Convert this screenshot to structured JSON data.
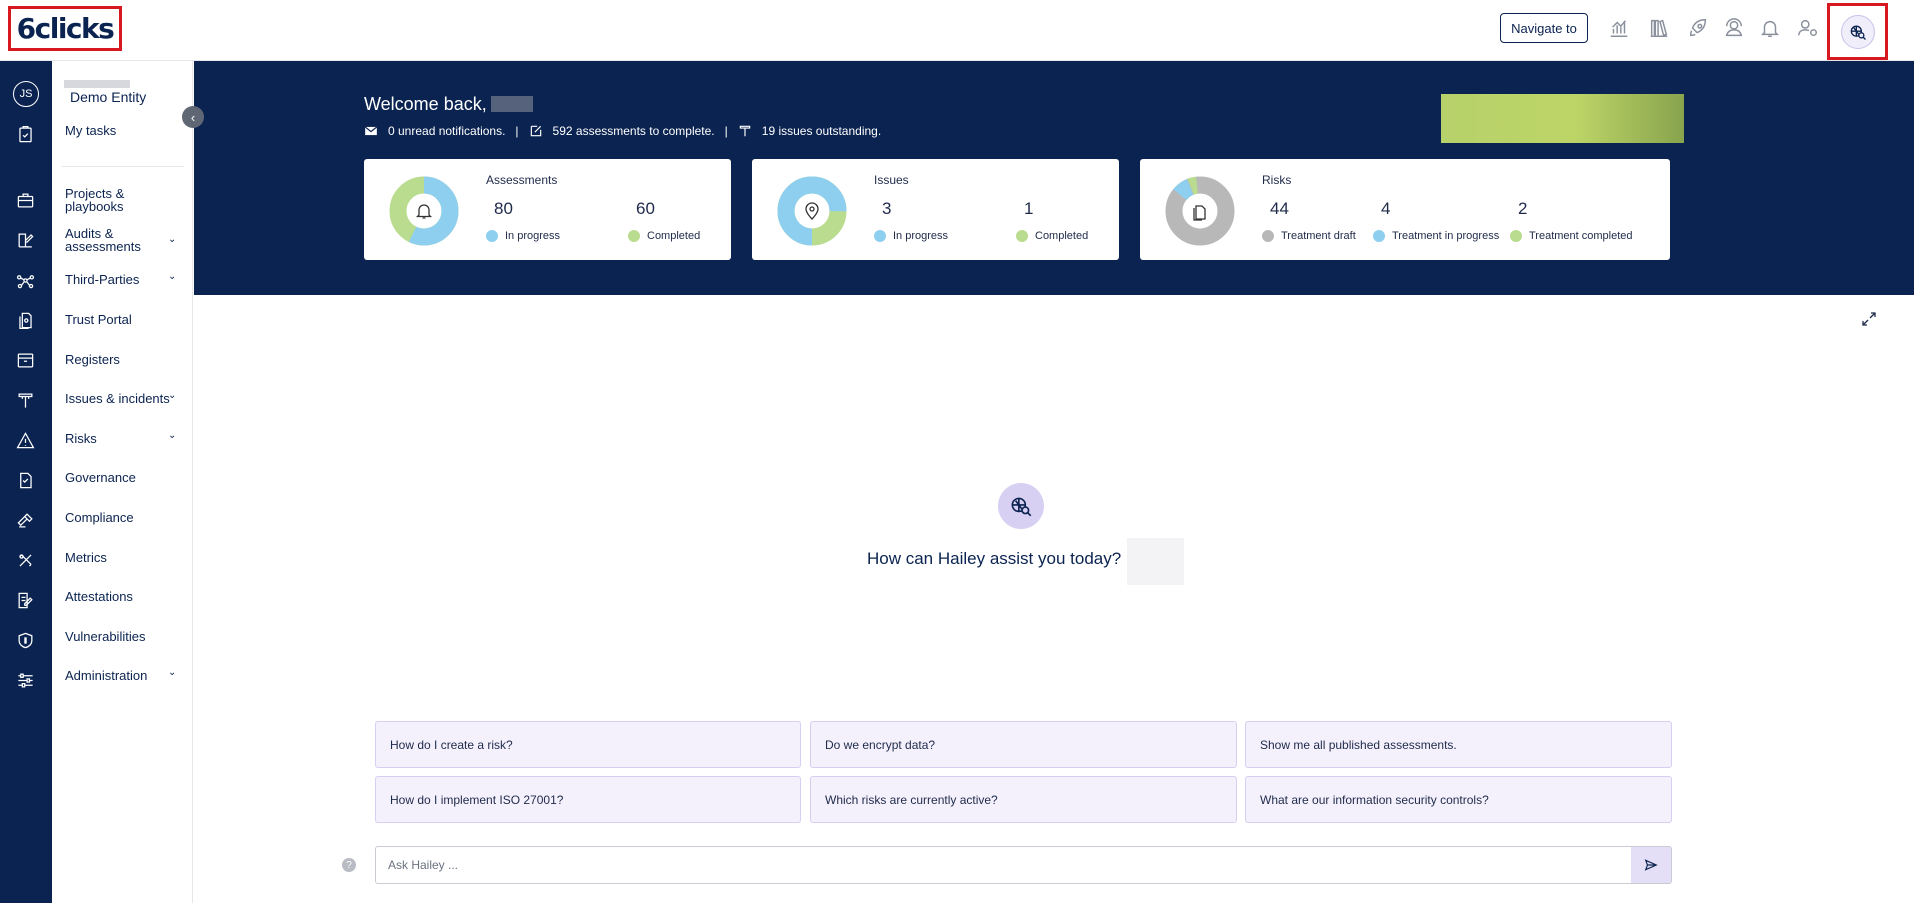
{
  "app": {
    "logo": "6clicks"
  },
  "header": {
    "navigate_label": "Navigate to",
    "icons": [
      "analytics-icon",
      "library-icon",
      "rocket-icon",
      "contact-icon",
      "bell-icon",
      "user-settings-icon",
      "hailey-icon"
    ]
  },
  "rail": {
    "avatar_initials": "JS",
    "icons": [
      "tasks-icon",
      "briefcase-icon",
      "edit-icon",
      "network-icon",
      "document-icon",
      "register-icon",
      "tools-icon",
      "warning-icon",
      "governance-icon",
      "compliance-icon",
      "metrics-icon",
      "attestation-icon",
      "shield-icon",
      "sliders-icon"
    ]
  },
  "menu": {
    "entity": "Demo Entity",
    "my_tasks": "My tasks",
    "items": [
      {
        "label": "Projects & playbooks"
      },
      {
        "label": "Audits & assessments"
      },
      {
        "label": "Third-Parties"
      },
      {
        "label": "Trust Portal"
      },
      {
        "label": "Registers"
      },
      {
        "label": "Issues & incidents"
      },
      {
        "label": "Risks"
      },
      {
        "label": "Governance"
      },
      {
        "label": "Compliance"
      },
      {
        "label": "Metrics"
      },
      {
        "label": "Attestations"
      },
      {
        "label": "Vulnerabilities"
      },
      {
        "label": "Administration"
      }
    ]
  },
  "hero": {
    "welcome": "Welcome back,",
    "notifications": "0 unread notifications.",
    "assessments_text": "592 assessments to complete.",
    "issues_text": "19 issues outstanding.",
    "separator": "|"
  },
  "cards": {
    "assessments": {
      "title": "Assessments",
      "stats": [
        {
          "value": "80",
          "label": "In progress",
          "color": "#8ecfef"
        },
        {
          "value": "60",
          "label": "Completed",
          "color": "#b9dc8f"
        }
      ]
    },
    "issues": {
      "title": "Issues",
      "stats": [
        {
          "value": "3",
          "label": "In progress",
          "color": "#8ecfef"
        },
        {
          "value": "1",
          "label": "Completed",
          "color": "#b9dc8f"
        }
      ]
    },
    "risks": {
      "title": "Risks",
      "stats": [
        {
          "value": "44",
          "label": "Treatment draft",
          "color": "#b8b8b8"
        },
        {
          "value": "4",
          "label": "Treatment in progress",
          "color": "#8ecfef"
        },
        {
          "value": "2",
          "label": "Treatment completed",
          "color": "#b9dc8f"
        }
      ]
    }
  },
  "assistant": {
    "prompt": "How can Hailey assist you today?",
    "suggestions": [
      "How do I create a risk?",
      "Do we encrypt data?",
      "Show me all published assessments.",
      "How do I implement ISO 27001?",
      "Which risks are currently active?",
      "What are our information security controls?"
    ],
    "input_placeholder": "Ask Hailey ..."
  },
  "colors": {
    "navy": "#0b2350",
    "accent_red": "#d7191f",
    "in_progress": "#8ecfef",
    "completed": "#b9dc8f",
    "draft": "#b8b8b8"
  }
}
